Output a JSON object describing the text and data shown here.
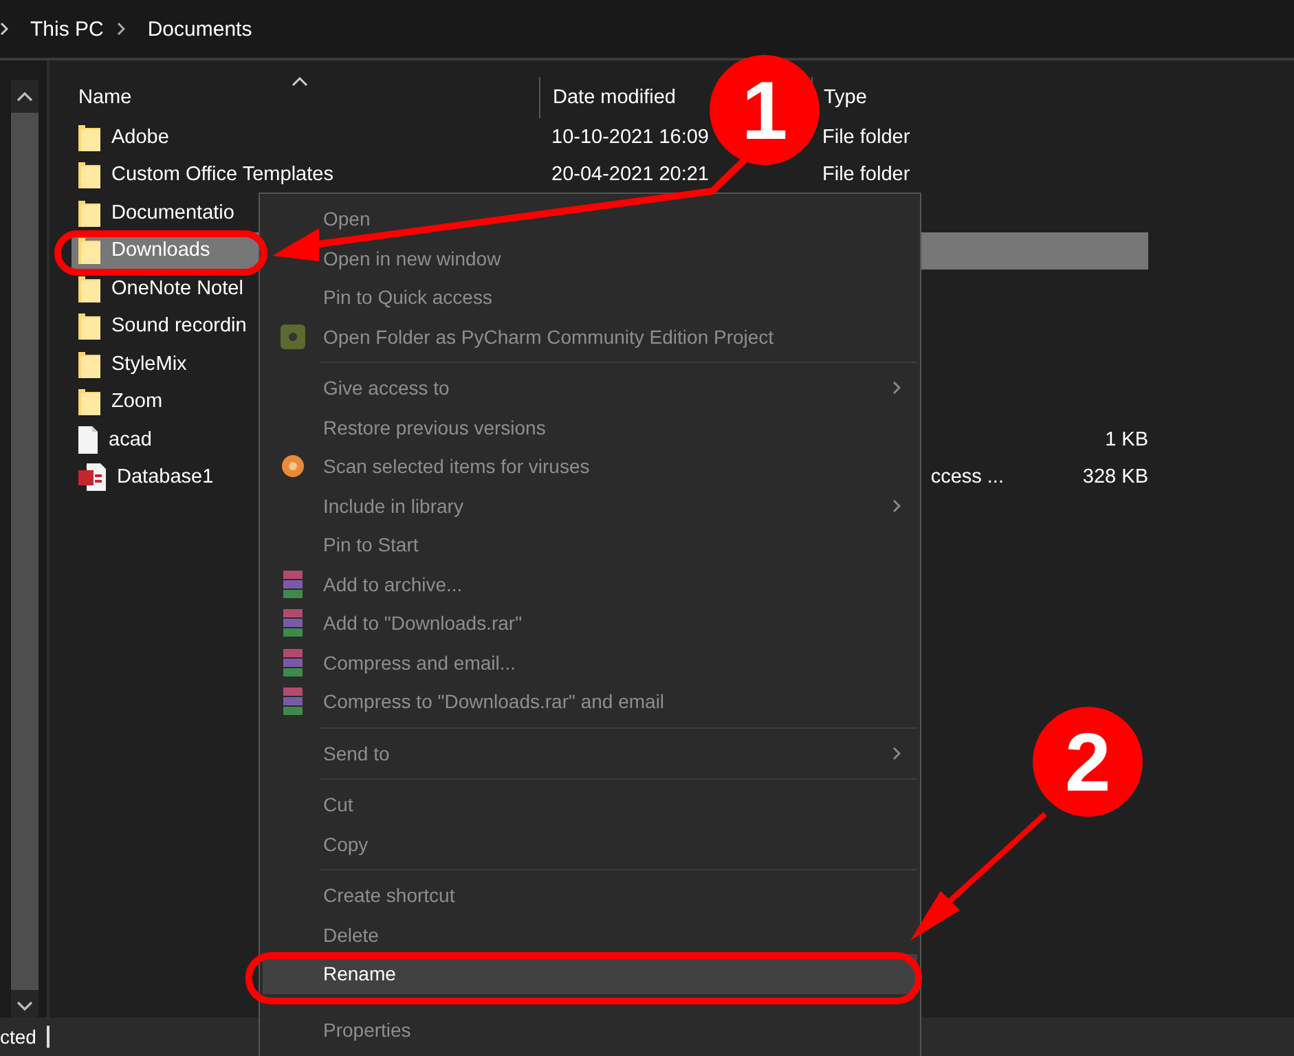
{
  "breadcrumb": [
    "This PC",
    "Documents"
  ],
  "columns": [
    "Name",
    "Date modified",
    "Type"
  ],
  "rows": [
    {
      "kind": "folder",
      "name": "Adobe",
      "date": "10-10-2021 16:09",
      "type": "File folder",
      "selected": false
    },
    {
      "kind": "folder",
      "name": "Custom Office Templates",
      "date": "20-04-2021 20:21",
      "type": "File folder",
      "selected": false
    },
    {
      "kind": "folder",
      "name": "Documentatio",
      "selected": false
    },
    {
      "kind": "folder",
      "name": "Downloads",
      "selected": true
    },
    {
      "kind": "folder",
      "name": "OneNote Notel",
      "selected": false
    },
    {
      "kind": "folder",
      "name": "Sound recordin",
      "selected": false
    },
    {
      "kind": "folder",
      "name": "StyleMix",
      "selected": false
    },
    {
      "kind": "folder",
      "name": "Zoom",
      "selected": false
    },
    {
      "kind": "file",
      "name": "acad",
      "size": "1 KB",
      "selected": false
    },
    {
      "kind": "database",
      "name": "Database1",
      "type": "ccess ...",
      "type_cut": true,
      "size": "328 KB",
      "selected": false
    }
  ],
  "context_menu": [
    {
      "kind": "item",
      "label": "Open",
      "selected": false
    },
    {
      "kind": "item",
      "label": "Open in new window",
      "selected": false
    },
    {
      "kind": "item",
      "label": "Pin to Quick access",
      "selected": false
    },
    {
      "kind": "app-item",
      "label": "Open Folder as PyCharm Community Edition Project",
      "selected": false
    },
    {
      "kind": "separator"
    },
    {
      "kind": "item",
      "label": "Give access to",
      "submenu": true,
      "selected": false
    },
    {
      "kind": "item",
      "label": "Restore previous versions",
      "selected": false
    },
    {
      "kind": "scan-item",
      "label": "Scan selected items for viruses",
      "selected": false
    },
    {
      "kind": "item",
      "label": "Include in library",
      "submenu": true,
      "selected": false
    },
    {
      "kind": "item",
      "label": "Pin to Start",
      "selected": false
    },
    {
      "kind": "archive-item",
      "label": "Add to archive...",
      "selected": false
    },
    {
      "kind": "archive-item",
      "label": "Add to \"Downloads.rar\"",
      "selected": false
    },
    {
      "kind": "archive-item",
      "label": "Compress and email...",
      "selected": false
    },
    {
      "kind": "archive-item",
      "label": "Compress to \"Downloads.rar\" and email",
      "selected": false
    },
    {
      "kind": "separator"
    },
    {
      "kind": "item",
      "label": "Send to",
      "submenu": true,
      "selected": false
    },
    {
      "kind": "separator"
    },
    {
      "kind": "item",
      "label": "Cut",
      "selected": false
    },
    {
      "kind": "item",
      "label": "Copy",
      "selected": false
    },
    {
      "kind": "separator"
    },
    {
      "kind": "item",
      "label": "Create shortcut",
      "selected": false
    },
    {
      "kind": "item",
      "label": "Delete",
      "selected": false
    },
    {
      "kind": "item",
      "label": "Rename",
      "selected": true
    },
    {
      "kind": "item",
      "label": "Properties",
      "selected": false
    }
  ],
  "status_bar": "cted",
  "annotations": [
    "1",
    "2"
  ]
}
